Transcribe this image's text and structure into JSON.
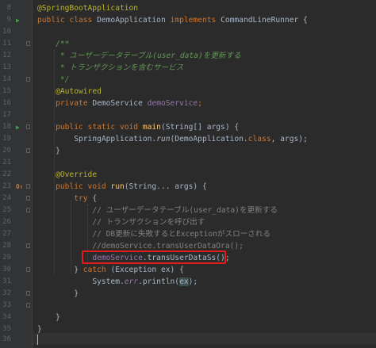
{
  "line_numbers": [
    "8",
    "9",
    "10",
    "11",
    "12",
    "13",
    "14",
    "15",
    "16",
    "17",
    "18",
    "19",
    "20",
    "21",
    "22",
    "23",
    "24",
    "25",
    "26",
    "27",
    "28",
    "29",
    "30",
    "31",
    "32",
    "33",
    "34",
    "35",
    "36"
  ],
  "code": {
    "l8": {
      "ann": "@SpringBootApplication"
    },
    "l9": {
      "kw1": "public class ",
      "name": "DemoApplication ",
      "kw2": "implements ",
      "iface": "CommandLineRunner {"
    },
    "l11": {
      "doc": "/**"
    },
    "l12": {
      "doc": " * ユーザーデータテーブル(user_data)を更新する"
    },
    "l13": {
      "doc": " * トランザクションを含むサービス"
    },
    "l14": {
      "doc": " */"
    },
    "l15": {
      "ann": "@Autowired"
    },
    "l16": {
      "kw": "private ",
      "type": "DemoService ",
      "field": "demoService",
      "semi": ";"
    },
    "l18": {
      "kw": "public static void ",
      "fn": "main",
      "args": "(String[] args) {"
    },
    "l19": {
      "cls": "SpringApplication.",
      "method": "run",
      "open": "(DemoApplication.",
      "kw": "class",
      "rest": ", args);"
    },
    "l20": {
      "text": "}"
    },
    "l22": {
      "ann": "@Override"
    },
    "l23": {
      "kw": "public void ",
      "fn": "run",
      "args": "(String... args) {"
    },
    "l24": {
      "kw": "try",
      "rest": " {"
    },
    "l25": {
      "cmt": "// ユーザーデータテーブル(user_data)を更新する"
    },
    "l26": {
      "cmt": "// トランザクションを呼び出す"
    },
    "l27": {
      "cmt": "// DB更新に失敗するとExceptionがスローされる"
    },
    "l28": {
      "cmt": "//demoService.transUserDataOra();"
    },
    "l29": {
      "field": "demoService",
      "call": ".transUserDataSs();"
    },
    "l30": {
      "open": "} ",
      "kw": "catch",
      "rest": " (Exception ex) {"
    },
    "l31": {
      "sys": "System.",
      "err": "err",
      "call": ".println(",
      "arg": "ex",
      "end": ");"
    },
    "l32": {
      "text": "}"
    },
    "l34": {
      "text": "}"
    },
    "l35": {
      "text": "}"
    }
  },
  "gutter_icons": {
    "run": "▶",
    "override": "O↑"
  },
  "colors": {
    "background": "#2b2b2b",
    "keyword": "#cc7832",
    "annotation": "#bbb529",
    "doc_comment": "#629755",
    "comment": "#808080",
    "method": "#ffc66d",
    "field": "#9876aa",
    "highlight_box": "#e31b1b"
  }
}
